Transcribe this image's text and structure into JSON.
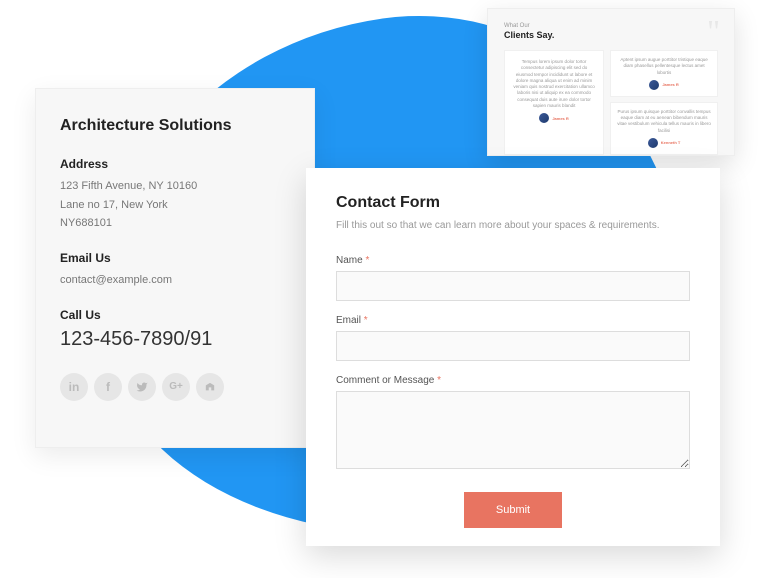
{
  "contactInfo": {
    "title": "Architecture Solutions",
    "address": {
      "label": "Address",
      "line1": "123 Fifth Avenue, NY 10160",
      "line2": "Lane no 17, New York",
      "line3": "NY688101"
    },
    "email": {
      "label": "Email Us",
      "value": "contact@example.com"
    },
    "phone": {
      "label": "Call Us",
      "value": "123-456-7890/91"
    }
  },
  "testimonials": {
    "header": "What Our",
    "title": "Clients Say.",
    "items": {
      "t1": "Tempus lorem ipsum dolor tortor consectetur adipiscing elit sed do eiusmod tempor incididunt ut labore et dolore magna aliqua ut enim ad minim veniam quis nostrud exercitation ullamco laboris nisi ut aliquip ex ea commodo consequat duis aute irure dolor tortor sapien mauris blandit",
      "t2": "Aptent ipsum augue porttitor tristique eaque diam phasellus pellentesque lectus amet lobortis",
      "t3": "Purus ipsum quisque porttitor convallis tempus eaque diam at eu aenean bibendum mauris vitae vestibulum vehicula tellus mauris in libero facilisi",
      "author1": "James R",
      "author2": "James R",
      "author3": "Kenneth T"
    }
  },
  "contactForm": {
    "title": "Contact Form",
    "subtitle": "Fill this out so that we can learn more about your spaces & requirements.",
    "nameLabel": "Name",
    "emailLabel": "Email",
    "commentLabel": "Comment or Message",
    "submitLabel": "Submit",
    "requiredMark": "*"
  }
}
